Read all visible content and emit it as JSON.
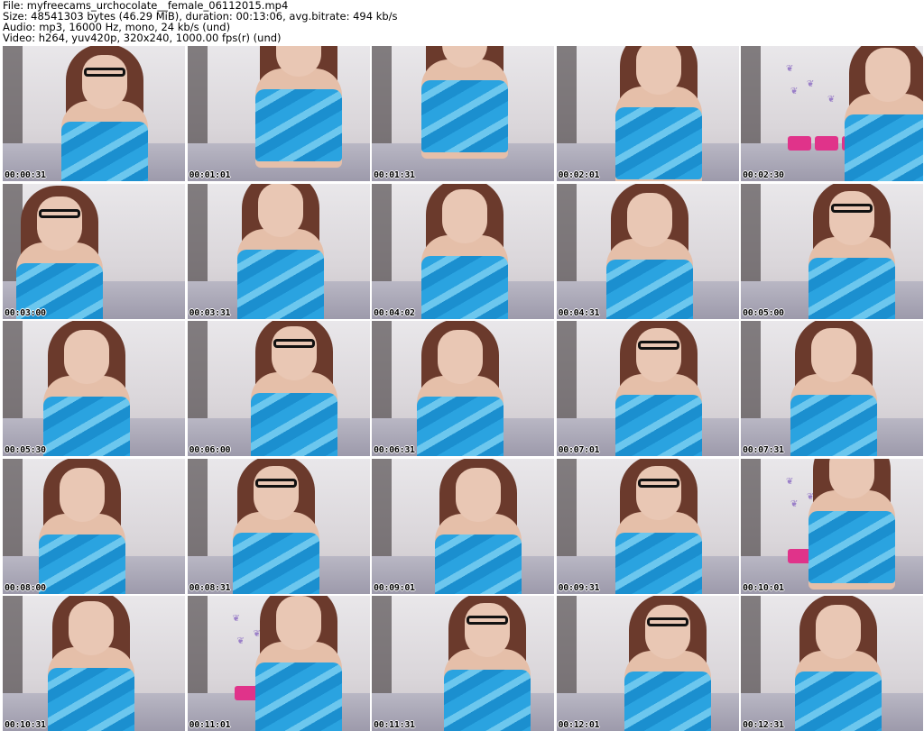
{
  "header": {
    "file": "File: myfreecams_urchocolate__female_06112015.mp4",
    "size": "Size: 48541303 bytes (46.29 MiB), duration: 00:13:06, avg.bitrate: 494 kb/s",
    "audio": "Audio: mp3, 16000 Hz, mono, 24 kb/s (und)",
    "video": "Video: h264, yuv420p, 320x240, 1000.00 fps(r) (und)"
  },
  "thumbnails": [
    {
      "time": "00:00:31"
    },
    {
      "time": "00:01:01"
    },
    {
      "time": "00:01:31"
    },
    {
      "time": "00:02:01"
    },
    {
      "time": "00:02:30"
    },
    {
      "time": "00:03:00"
    },
    {
      "time": "00:03:31"
    },
    {
      "time": "00:04:02"
    },
    {
      "time": "00:04:31"
    },
    {
      "time": "00:05:00"
    },
    {
      "time": "00:05:30"
    },
    {
      "time": "00:06:00"
    },
    {
      "time": "00:06:31"
    },
    {
      "time": "00:07:01"
    },
    {
      "time": "00:07:31"
    },
    {
      "time": "00:08:00"
    },
    {
      "time": "00:08:31"
    },
    {
      "time": "00:09:01"
    },
    {
      "time": "00:09:31"
    },
    {
      "time": "00:10:01"
    },
    {
      "time": "00:10:31"
    },
    {
      "time": "00:11:01"
    },
    {
      "time": "00:11:31"
    },
    {
      "time": "00:12:01"
    },
    {
      "time": "00:12:31"
    }
  ]
}
